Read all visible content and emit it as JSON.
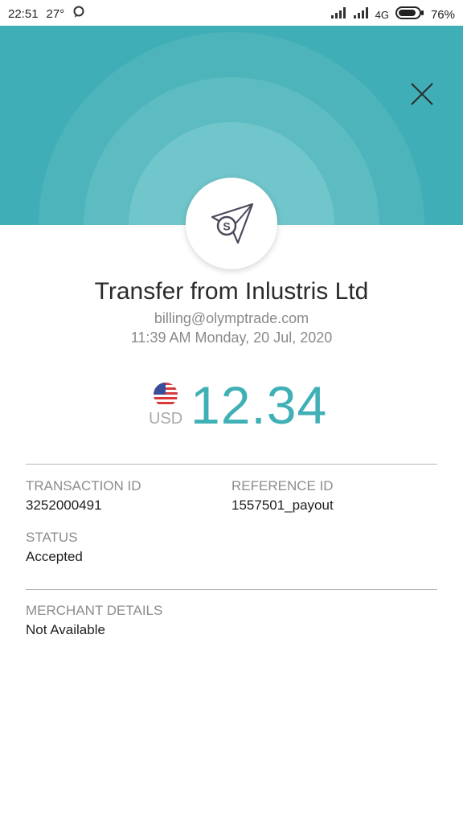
{
  "status_bar": {
    "time": "22:51",
    "temperature": "27°",
    "network": "4G",
    "battery": "76%"
  },
  "header": {
    "close_icon": "close-icon",
    "colors": {
      "background": "#40aeb6"
    }
  },
  "transaction": {
    "title": "Transfer from Inlustris Ltd",
    "email": "billing@olymptrade.com",
    "datetime": "11:39 AM Monday, 20 Jul, 2020",
    "currency": "USD",
    "amount": "12.34",
    "details": {
      "transaction_id_label": "TRANSACTION ID",
      "transaction_id_value": "3252000491",
      "reference_id_label": "REFERENCE ID",
      "reference_id_value": "1557501_payout",
      "status_label": "STATUS",
      "status_value": "Accepted",
      "merchant_label": "MERCHANT DETAILS",
      "merchant_value": "Not Available"
    }
  }
}
